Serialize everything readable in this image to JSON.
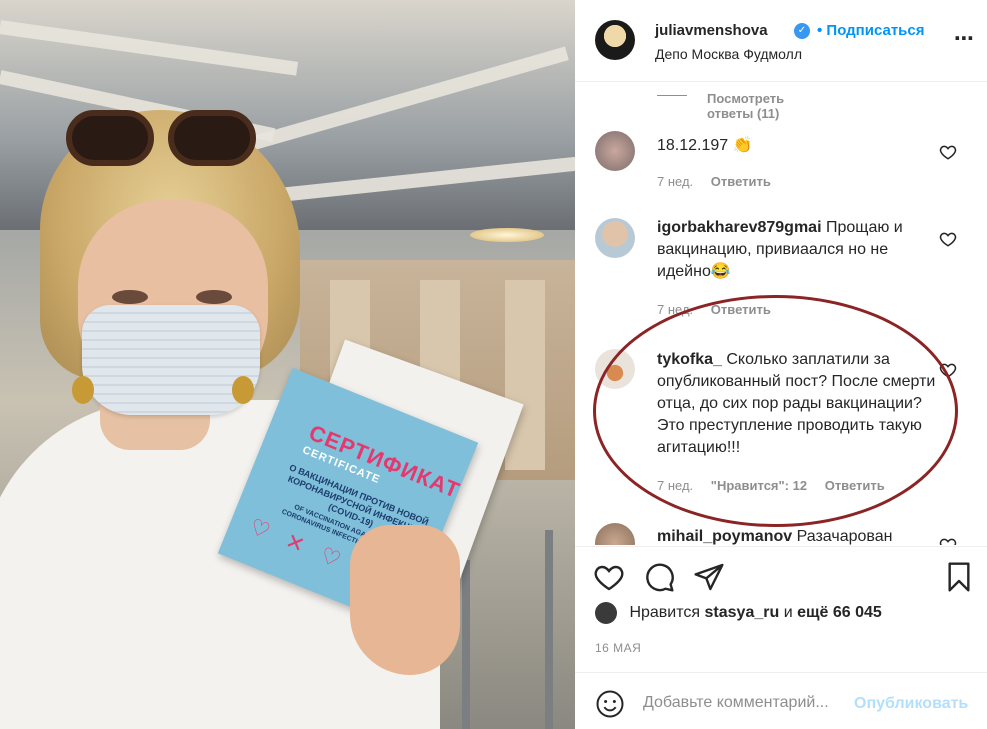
{
  "post": {
    "username": "juliavmenshova",
    "follow_label": "• Подписаться",
    "location": "Депо Москва Фудмолл",
    "more_icon": "⋯"
  },
  "certificate": {
    "title": "СЕРТИФИКАТ",
    "subtitle": "CERTIFICATE",
    "text_ru": "О ВАКЦИНАЦИИ ПРОТИВ НОВОЙ КОРОНАВИРУСНОЙ ИНФЕКЦИИ (COVID-19)",
    "text_en": "OF VACCINATION AGAINST NEW CORONAVIRUS INFECTION (COVID-19)"
  },
  "comments": {
    "view_replies": "Посмотреть ответы (11)",
    "items": [
      {
        "user": "",
        "text": "18.12.197 👏",
        "age": "7 нед.",
        "likes": "",
        "reply": "Ответить"
      },
      {
        "user": "igorbakharev879gmai",
        "text": "Прощаю и вакцинацию, привиаался но не идейно😂",
        "age": "7 нед.",
        "likes": "",
        "reply": "Ответить"
      },
      {
        "user": "tykofka_",
        "text": "Сколько заплатили за опубликованный пост? После смерти отца, до сих пор рады вакцинации? Это преступление проводить такую агитацию!!!",
        "age": "7 нед.",
        "likes": "\"Нравится\": 12",
        "reply": "Ответить"
      },
      {
        "user": "mihail_poymanov",
        "text": "Разачарован",
        "age": "",
        "likes": "",
        "reply": ""
      }
    ]
  },
  "likes": {
    "prefix": "Нравится",
    "user": "stasya_ru",
    "middle": "и",
    "count": "ещё 66 045"
  },
  "date": "16 МАЯ",
  "add_comment": {
    "placeholder": "Добавьте комментарий...",
    "publish_label": "Опубликовать"
  },
  "colors": {
    "link_blue": "#0095f6",
    "publish_disabled": "#b2dffc",
    "highlight_circle": "#8b2424"
  }
}
